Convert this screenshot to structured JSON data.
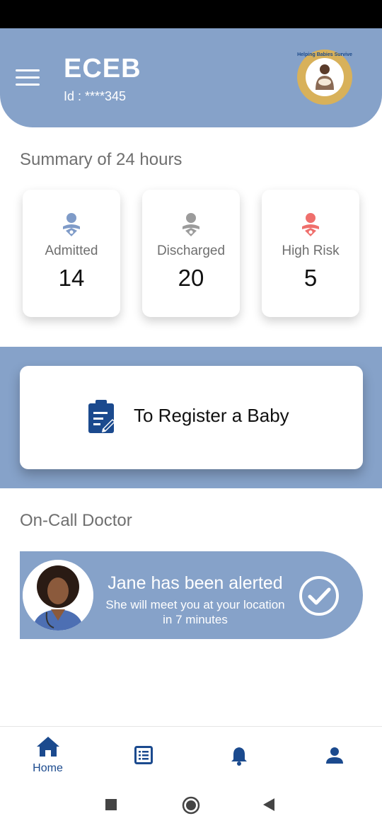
{
  "header": {
    "title": "ECEB",
    "user_id": "Id : ****345",
    "logo_text": "Helping Babies Survive"
  },
  "summary": {
    "title": "Summary of 24 hours",
    "cards": [
      {
        "label": "Admitted",
        "value": "14",
        "icon": "baby-icon",
        "color": "#7f9bc8"
      },
      {
        "label": "Discharged",
        "value": "20",
        "icon": "baby-icon",
        "color": "#9b9b9b"
      },
      {
        "label": "High Risk",
        "value": "5",
        "icon": "baby-icon",
        "color": "#ef6f6c"
      }
    ]
  },
  "register": {
    "label": "To Register a Baby",
    "icon": "clipboard-edit-icon"
  },
  "oncall": {
    "title": "On-Call Doctor",
    "alert_title": "Jane has been alerted",
    "alert_line1": "She will meet you at your location",
    "alert_line2": "in 7 minutes"
  },
  "bottom_nav": [
    {
      "label": "Home",
      "icon": "home-icon",
      "active": true
    },
    {
      "label": "",
      "icon": "list-icon"
    },
    {
      "label": "",
      "icon": "bell-icon"
    },
    {
      "label": "",
      "icon": "person-icon"
    }
  ],
  "colors": {
    "accent": "#86a2c9",
    "nav": "#1b4a8e"
  }
}
